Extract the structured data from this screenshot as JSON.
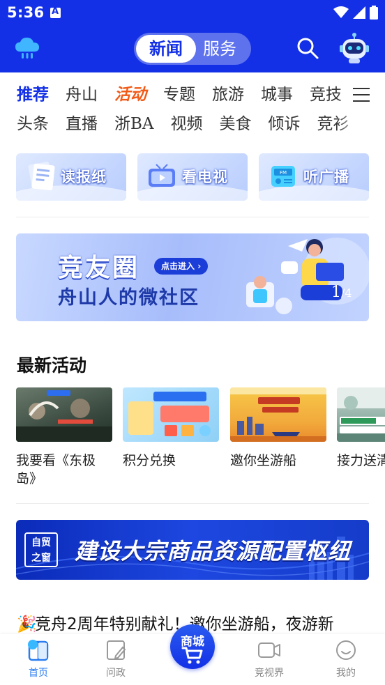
{
  "status_bar": {
    "time": "5:36"
  },
  "app_bar": {
    "segment_news": "新闻",
    "segment_service": "服务"
  },
  "channels": {
    "row1": [
      "推荐",
      "舟山",
      "活动",
      "专题",
      "旅游",
      "城事",
      "竞技"
    ],
    "row2": [
      "头条",
      "直播",
      "浙BA",
      "视频",
      "美食",
      "倾诉",
      "竞衫"
    ]
  },
  "quick_access": [
    {
      "label": "读报纸"
    },
    {
      "label": "看电视"
    },
    {
      "label": "听广播"
    }
  ],
  "banner": {
    "title": "竞友圈",
    "cta": "点击进入",
    "subtitle": "舟山人的微社区",
    "page_current": "1",
    "page_total": "/4"
  },
  "latest": {
    "title": "最新活动",
    "items": [
      {
        "title": "我要看《东极岛》"
      },
      {
        "title": "积分兑换"
      },
      {
        "title": "邀你坐游船"
      },
      {
        "title": "接力送清"
      }
    ]
  },
  "promo": {
    "badge": "自贸之窗",
    "badge_line1": "自贸",
    "badge_line2": "之窗",
    "text": "建设大宗商品资源配置枢纽"
  },
  "headline": {
    "emoji": "🎉",
    "text": "竞舟2周年特别献礼！邀你坐游船，夜游新"
  },
  "tabbar": {
    "home": "首页",
    "wenzheng": "问政",
    "mall": "商城",
    "jingshijie": "竞视界",
    "me": "我的"
  },
  "colors": {
    "brand_blue": "#1330e6",
    "activity_orange": "#f25a16",
    "tab_active": "#2a7df0"
  }
}
